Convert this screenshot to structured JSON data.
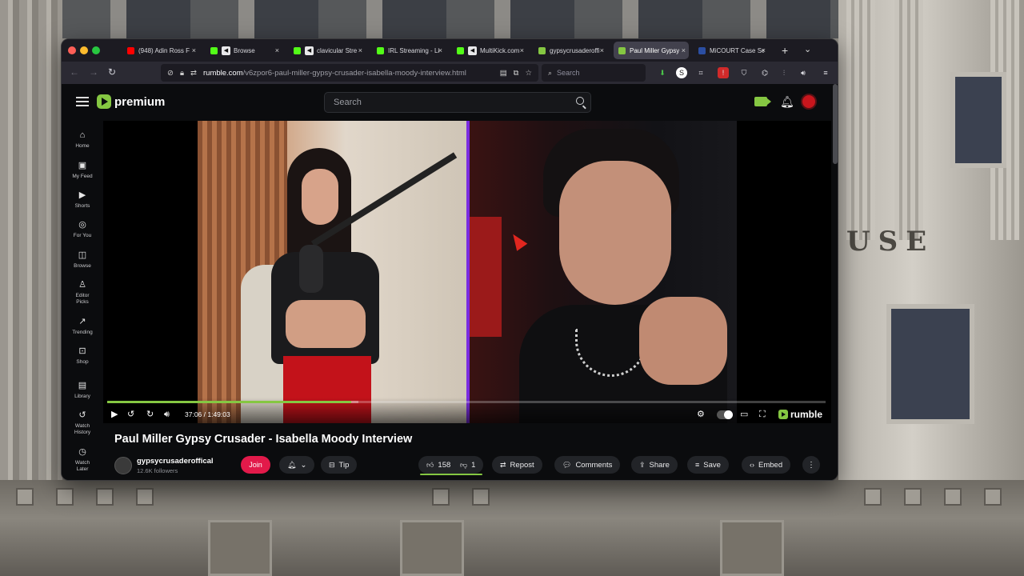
{
  "browser": {
    "tabs": [
      {
        "label": "(948) Adin Ross F",
        "fav_color": "#ff0000",
        "muted": false,
        "active": false
      },
      {
        "label": "Browse",
        "fav_color": "#53fc18",
        "muted": true,
        "active": false
      },
      {
        "label": "clavicular Stre",
        "fav_color": "#53fc18",
        "muted": true,
        "active": false
      },
      {
        "label": "IRL Streaming - Li",
        "fav_color": "#53fc18",
        "muted": false,
        "active": false
      },
      {
        "label": "MultiKick.com",
        "fav_color": "#53fc18",
        "muted": true,
        "active": false
      },
      {
        "label": "gypsycrusaderoffi",
        "fav_color": "#85c742",
        "muted": false,
        "active": false
      },
      {
        "label": "Paul Miller Gypsy",
        "fav_color": "#85c742",
        "muted": false,
        "active": true
      },
      {
        "label": "MiCOURT Case Se",
        "fav_color": "#2b4ea2",
        "muted": false,
        "active": false
      }
    ],
    "url_host": "rumble.com",
    "url_path": "/v6zpor6-paul-miller-gypsy-crusader-isabella-moody-interview.html",
    "search_placeholder": "Search"
  },
  "site": {
    "logo_text": "premium",
    "search_placeholder": "Search",
    "accent": "#85c742"
  },
  "sidebar": {
    "items": [
      {
        "label": "Home",
        "icon": "home-icon"
      },
      {
        "label": "My Feed",
        "icon": "feed-icon"
      },
      {
        "label": "Shorts",
        "icon": "shorts-icon"
      },
      {
        "label": "For You",
        "icon": "for-you-icon"
      },
      {
        "label": "Browse",
        "icon": "browse-icon"
      },
      {
        "label": "Editor Picks",
        "icon": "editor-picks-icon"
      },
      {
        "label": "Trending",
        "icon": "trending-icon"
      },
      {
        "label": "Shop",
        "icon": "shop-icon"
      },
      {
        "label": "Library",
        "icon": "library-icon"
      },
      {
        "label": "Watch History",
        "icon": "history-icon"
      },
      {
        "label": "Watch Later",
        "icon": "clock-icon"
      }
    ]
  },
  "player": {
    "current_time": "37:06",
    "duration": "1:49:03",
    "time_display": "37:06 / 1:49:03",
    "progress_fraction": 0.34,
    "brand": "rumble"
  },
  "video": {
    "title": "Paul Miller Gypsy Crusader - Isabella Moody Interview",
    "channel_name": "gypsycrusaderoffical",
    "followers": "12.6K followers",
    "join_label": "Join",
    "tip_label": "Tip",
    "likes": "158",
    "dislikes": "1",
    "repost_label": "Repost",
    "comments_label": "Comments",
    "share_label": "Share",
    "save_label": "Save",
    "embed_label": "Embed"
  }
}
